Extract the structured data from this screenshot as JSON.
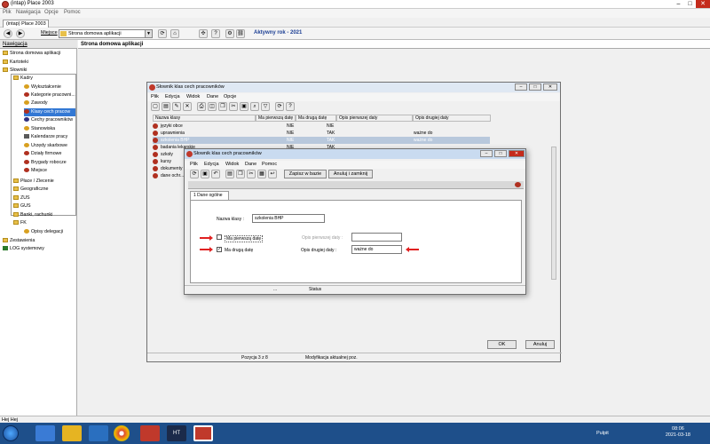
{
  "app": {
    "title": "(intap)  Place 2003"
  },
  "menu": [
    "Plik",
    "Nawigacja",
    "Opcje",
    "Pomoc"
  ],
  "tabstrip": {
    "tab": "(intap)  Place 2003"
  },
  "toolbar": {
    "location_label": "Miejsce",
    "location_value": "Strona domowa aplikacji",
    "year": "Aktywny rok - 2021"
  },
  "nav": {
    "header": "Nawigacja",
    "items": [
      "Strona domowa aplikacji",
      "Kartoteki",
      "Słowniki",
      "Kadry",
      "Wykształcenie",
      "Kategorie pracowni...",
      "Zawody",
      "Klasy cech pracow",
      "Cechy pracowników",
      "Stanowiska",
      "Kalendarze pracy",
      "Urzędy skarbowe",
      "Działy firmowe",
      "Brygady robocze",
      "Miejsce",
      "Płace / Zlecenie",
      "Geograficzne",
      "ZUS",
      "GUS",
      "Banki, rachunki",
      "FK",
      "Opisy delegacji",
      "Zestawienia",
      "LOG systemowy"
    ]
  },
  "main": {
    "header": "Strona domowa aplikacji"
  },
  "dict_window": {
    "title": "Słownik klas cech pracowników",
    "menu": [
      "Plik",
      "Edycja",
      "Widok",
      "Dane",
      "Opcje"
    ],
    "columns": [
      "Nazwa klasy",
      "Ma pierwszą datę",
      "Ma drugą datę",
      "Opis pierwszej daty",
      "Opis drugiej daty"
    ],
    "rows": [
      [
        "języki obce",
        "NIE",
        "NIE",
        "",
        ""
      ],
      [
        "uprawnienia",
        "NIE",
        "TAK",
        "",
        "ważne do"
      ],
      [
        "szkolenia BHP",
        "NIE",
        "TAK",
        "",
        "ważne do"
      ],
      [
        "badania lekarskie",
        "NIE",
        "TAK",
        "",
        ""
      ],
      [
        "szkoły",
        "",
        "",
        "",
        ""
      ],
      [
        "kursy",
        "",
        "",
        "",
        ""
      ],
      [
        "dokumenty",
        "",
        "",
        "",
        ""
      ],
      [
        "dane ochr...",
        "",
        "",
        "",
        ""
      ]
    ],
    "ok": "OK",
    "cancel": "Anuluj",
    "status_pos": "Pozycja 3 z 8",
    "status_mode": "Modyfikacja aktualnej poz."
  },
  "edit_window": {
    "title": "Słownik klas cech pracowników",
    "menu": [
      "Plik",
      "Edycja",
      "Widok",
      "Dane",
      "Pomoc"
    ],
    "save_label": "Zapisz w bazie",
    "cancel_label": "Anuluj i zamknij",
    "tab": "1 Dane ogólne",
    "name_label": "Nazwa klasy :",
    "name_value": "szkolenia BHP",
    "has_first": "Ma pierwszą datę",
    "has_second": "Ma drugą datę",
    "first_desc_label": "Opis pierwszej daty :",
    "first_desc_value": "",
    "second_desc_label": "Opis drugiej daty :",
    "second_desc_value": "ważne do",
    "status_left": "...",
    "status_right": "Status"
  },
  "statusbar": "Hej Hej",
  "taskbar": {
    "desktop": "Pulpit",
    "time": "08:06",
    "date": "2021-03-18"
  },
  "colors": {
    "accent": "#1c3f94",
    "selection": "#3378d4",
    "taskbar": "#1e4f8a",
    "arrow": "#e02020"
  }
}
